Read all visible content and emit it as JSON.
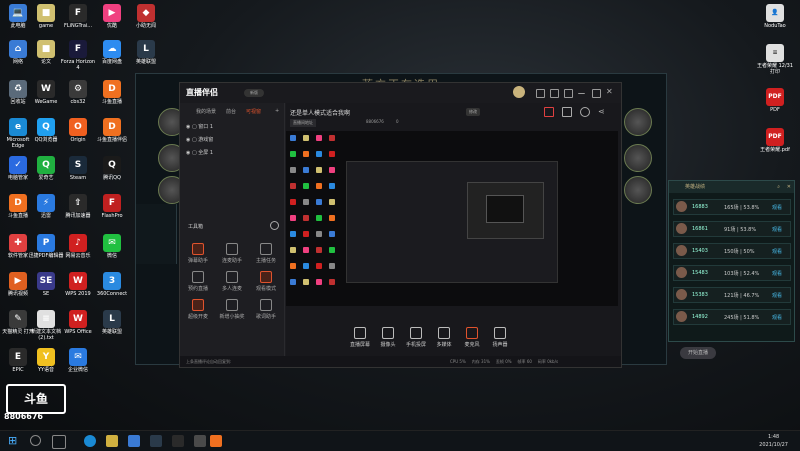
{
  "desktop": {
    "icons": [
      {
        "label": "此电脑",
        "color": "#3a7bd5",
        "glyph": "💻"
      },
      {
        "label": "game",
        "color": "#d0c070",
        "glyph": "■"
      },
      {
        "label": "FLiNGTrai...",
        "color": "#2a2a2a",
        "glyph": "F"
      },
      {
        "label": "优酷",
        "color": "#f04080",
        "glyph": "▶"
      },
      {
        "label": "小助无闻",
        "color": "#c03030",
        "glyph": "◆"
      },
      {
        "label": "网络",
        "color": "#3a7bd5",
        "glyph": "⌂"
      },
      {
        "label": "论文",
        "color": "#d0c070",
        "glyph": "■"
      },
      {
        "label": "Forza Horizon 4",
        "color": "#1a1a3a",
        "glyph": "F"
      },
      {
        "label": "百度网盘",
        "color": "#2d8cf0",
        "glyph": "☁"
      },
      {
        "label": "英雄联盟",
        "color": "#2a3a4a",
        "glyph": "L"
      },
      {
        "label": "回收站",
        "color": "#5a6a7a",
        "glyph": "♻"
      },
      {
        "label": "WeGame",
        "color": "#2a2a2a",
        "glyph": "W"
      },
      {
        "label": "cbs32",
        "color": "#3a3a3a",
        "glyph": "⚙"
      },
      {
        "label": "斗鱼直播",
        "color": "#f07020",
        "glyph": "D"
      },
      {
        "label": "Microsoft Edge",
        "color": "#1a8ad4",
        "glyph": "e"
      },
      {
        "label": "QQ浏览器",
        "color": "#20a0f0",
        "glyph": "Q"
      },
      {
        "label": "Origin",
        "color": "#f06020",
        "glyph": "O"
      },
      {
        "label": "斗鱼直播伴侣",
        "color": "#f07020",
        "glyph": "D"
      },
      {
        "label": "电脑管家",
        "color": "#2a6ae0",
        "glyph": "✓"
      },
      {
        "label": "爱奇艺",
        "color": "#20b040",
        "glyph": "Q"
      },
      {
        "label": "Steam",
        "color": "#1a2a3a",
        "glyph": "S"
      },
      {
        "label": "腾讯QQ",
        "color": "#1a1a1a",
        "glyph": "Q"
      },
      {
        "label": "斗鱼直播",
        "color": "#f07020",
        "glyph": "D"
      },
      {
        "label": "迅雷",
        "color": "#2a7ae0",
        "glyph": "⚡"
      },
      {
        "label": "腾讯加速器",
        "color": "#2a2a2a",
        "glyph": "⇧"
      },
      {
        "label": "FlashPro",
        "color": "#c02020",
        "glyph": "F"
      },
      {
        "label": "软件管家",
        "color": "#e04040",
        "glyph": "✚"
      },
      {
        "label": "迅捷PDF编辑器",
        "color": "#2a7ae0",
        "glyph": "P"
      },
      {
        "label": "网易云音乐",
        "color": "#d02020",
        "glyph": "♪"
      },
      {
        "label": "微信",
        "color": "#20c040",
        "glyph": "✉"
      },
      {
        "label": "腾讯视频",
        "color": "#e06020",
        "glyph": "▶"
      },
      {
        "label": "SE",
        "color": "#3a3a8a",
        "glyph": "SE"
      },
      {
        "label": "WPS 2019",
        "color": "#d02020",
        "glyph": "W"
      },
      {
        "label": "360Connect",
        "color": "#2a8ae0",
        "glyph": "3"
      },
      {
        "label": "天猫精灵 打开",
        "color": "#3a3a3a",
        "glyph": "✎"
      },
      {
        "label": "新建文本文档 (2).txt",
        "color": "#e0e0e0",
        "glyph": "≡"
      },
      {
        "label": "WPS Office",
        "color": "#d02020",
        "glyph": "W"
      },
      {
        "label": "英雄联盟",
        "color": "#2a3a4a",
        "glyph": "L"
      },
      {
        "label": "EPIC",
        "color": "#2a2a2a",
        "glyph": "E"
      },
      {
        "label": "YY语音",
        "color": "#f0c020",
        "glyph": "Y"
      },
      {
        "label": "企业微信",
        "color": "#2a7ae0",
        "glyph": "✉"
      }
    ],
    "right_icons": [
      {
        "label": "NoduTao",
        "color": "#e0e0e0",
        "glyph": "👤"
      },
      {
        "label": "王者荣耀 12/31 打印",
        "color": "#e0e0e0",
        "glyph": "≡"
      },
      {
        "label": "PDF",
        "color": "#d02020",
        "glyph": "PDF"
      },
      {
        "label": "王者荣耀.pdf",
        "color": "#d02020",
        "glyph": "PDF"
      }
    ]
  },
  "game": {
    "title": "蓝方正在选用"
  },
  "ranking": {
    "title": "英雄战绩",
    "rows": [
      {
        "score": "16883",
        "stat": "165场 | 53.8%",
        "action": "观看"
      },
      {
        "score": "16861",
        "stat": "91场 | 53.8%",
        "action": "观看"
      },
      {
        "score": "15403",
        "stat": "150场 | 50%",
        "action": "观看"
      },
      {
        "score": "15483",
        "stat": "103场 | 52.4%",
        "action": "观看"
      },
      {
        "score": "15383",
        "stat": "121场 | 46.7%",
        "action": "观看"
      },
      {
        "score": "14892",
        "stat": "245场 | 51.8%",
        "action": "观看"
      }
    ]
  },
  "app": {
    "logo": "直播伴侣",
    "version": "新版",
    "tabs": [
      "我的场景",
      "前台",
      "可视窗"
    ],
    "scenes": [
      "窗口 1",
      "游戏窗",
      "全屏 1"
    ],
    "toolbox_label": "工具箱",
    "tools": [
      "弹幕助手",
      "连麦助手",
      "主播任务",
      "预约直播",
      "多人连麦",
      "观看模式",
      "超级开麦",
      "新增小抽奖",
      "歌词助手"
    ],
    "stream_title": "还是单人模式适合我啊",
    "edit_label": "修改",
    "room_label": "直播间地址",
    "room_id": "8806676",
    "like_count": "0",
    "controls": [
      "直播屏幕",
      "摄像头",
      "手机投屏",
      "多媒体",
      "麦克风",
      "扬声器"
    ],
    "start_label": "开始直播",
    "status_text": "上条直播评论自动回复到:",
    "status_metrics": [
      "CPU 5%",
      "内存 31%",
      "丢帧 0%",
      "帧率 60",
      "码率 0kb/s"
    ]
  },
  "overlay": {
    "logo_text": "斗鱼",
    "id_number": "8806676"
  },
  "clock": {
    "time": "1:48",
    "date": "2021/10/27"
  }
}
